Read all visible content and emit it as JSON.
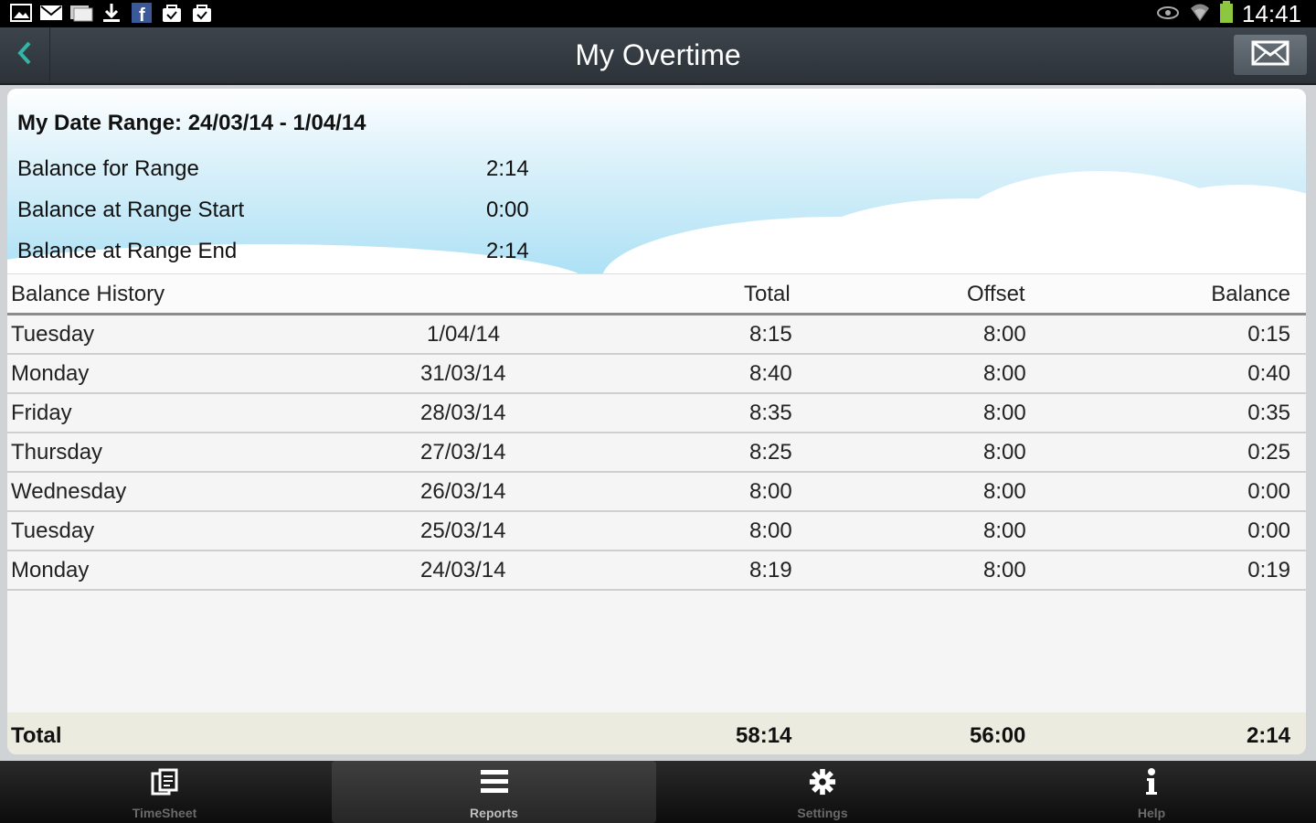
{
  "status_bar": {
    "notification_icons": [
      "image-icon",
      "mail-icon",
      "message-icon",
      "download-icon",
      "facebook-icon",
      "check-bag-icon",
      "check-bag-icon"
    ],
    "system_icons": [
      "eye-icon",
      "wifi-icon",
      "battery-icon"
    ],
    "time": "14:41"
  },
  "header": {
    "title": "My Overtime",
    "back_icon": "chevron-left-icon",
    "mail_icon": "envelope-icon"
  },
  "summary": {
    "date_range_label": "My Date Range: 24/03/14 - 1/04/14",
    "rows": [
      {
        "label": "Balance for Range",
        "value": "2:14"
      },
      {
        "label": "Balance at Range Start",
        "value": "0:00"
      },
      {
        "label": "Balance at Range End",
        "value": "2:14"
      }
    ]
  },
  "table": {
    "headers": {
      "history": "Balance History",
      "total": "Total",
      "offset": "Offset",
      "balance": "Balance"
    },
    "rows": [
      {
        "day": "Tuesday",
        "date": "1/04/14",
        "total": "8:15",
        "offset": "8:00",
        "balance": "0:15"
      },
      {
        "day": "Monday",
        "date": "31/03/14",
        "total": "8:40",
        "offset": "8:00",
        "balance": "0:40"
      },
      {
        "day": "Friday",
        "date": "28/03/14",
        "total": "8:35",
        "offset": "8:00",
        "balance": "0:35"
      },
      {
        "day": "Thursday",
        "date": "27/03/14",
        "total": "8:25",
        "offset": "8:00",
        "balance": "0:25"
      },
      {
        "day": "Wednesday",
        "date": "26/03/14",
        "total": "8:00",
        "offset": "8:00",
        "balance": "0:00"
      },
      {
        "day": "Tuesday",
        "date": "25/03/14",
        "total": "8:00",
        "offset": "8:00",
        "balance": "0:00"
      },
      {
        "day": "Monday",
        "date": "24/03/14",
        "total": "8:19",
        "offset": "8:00",
        "balance": "0:19"
      }
    ],
    "totals": {
      "label": "Total",
      "total": "58:14",
      "offset": "56:00",
      "balance": "2:14"
    }
  },
  "bottom_nav": {
    "items": [
      {
        "label": "TimeSheet",
        "icon": "timesheet-icon",
        "active": false
      },
      {
        "label": "Reports",
        "icon": "list-icon",
        "active": true
      },
      {
        "label": "Settings",
        "icon": "gear-icon",
        "active": false
      },
      {
        "label": "Help",
        "icon": "info-icon",
        "active": false
      }
    ]
  },
  "colors": {
    "action_bar": "#353b42",
    "back_arrow": "#33b5a5",
    "sky": "#aee1f5",
    "total_bar": "#ecebe0"
  }
}
